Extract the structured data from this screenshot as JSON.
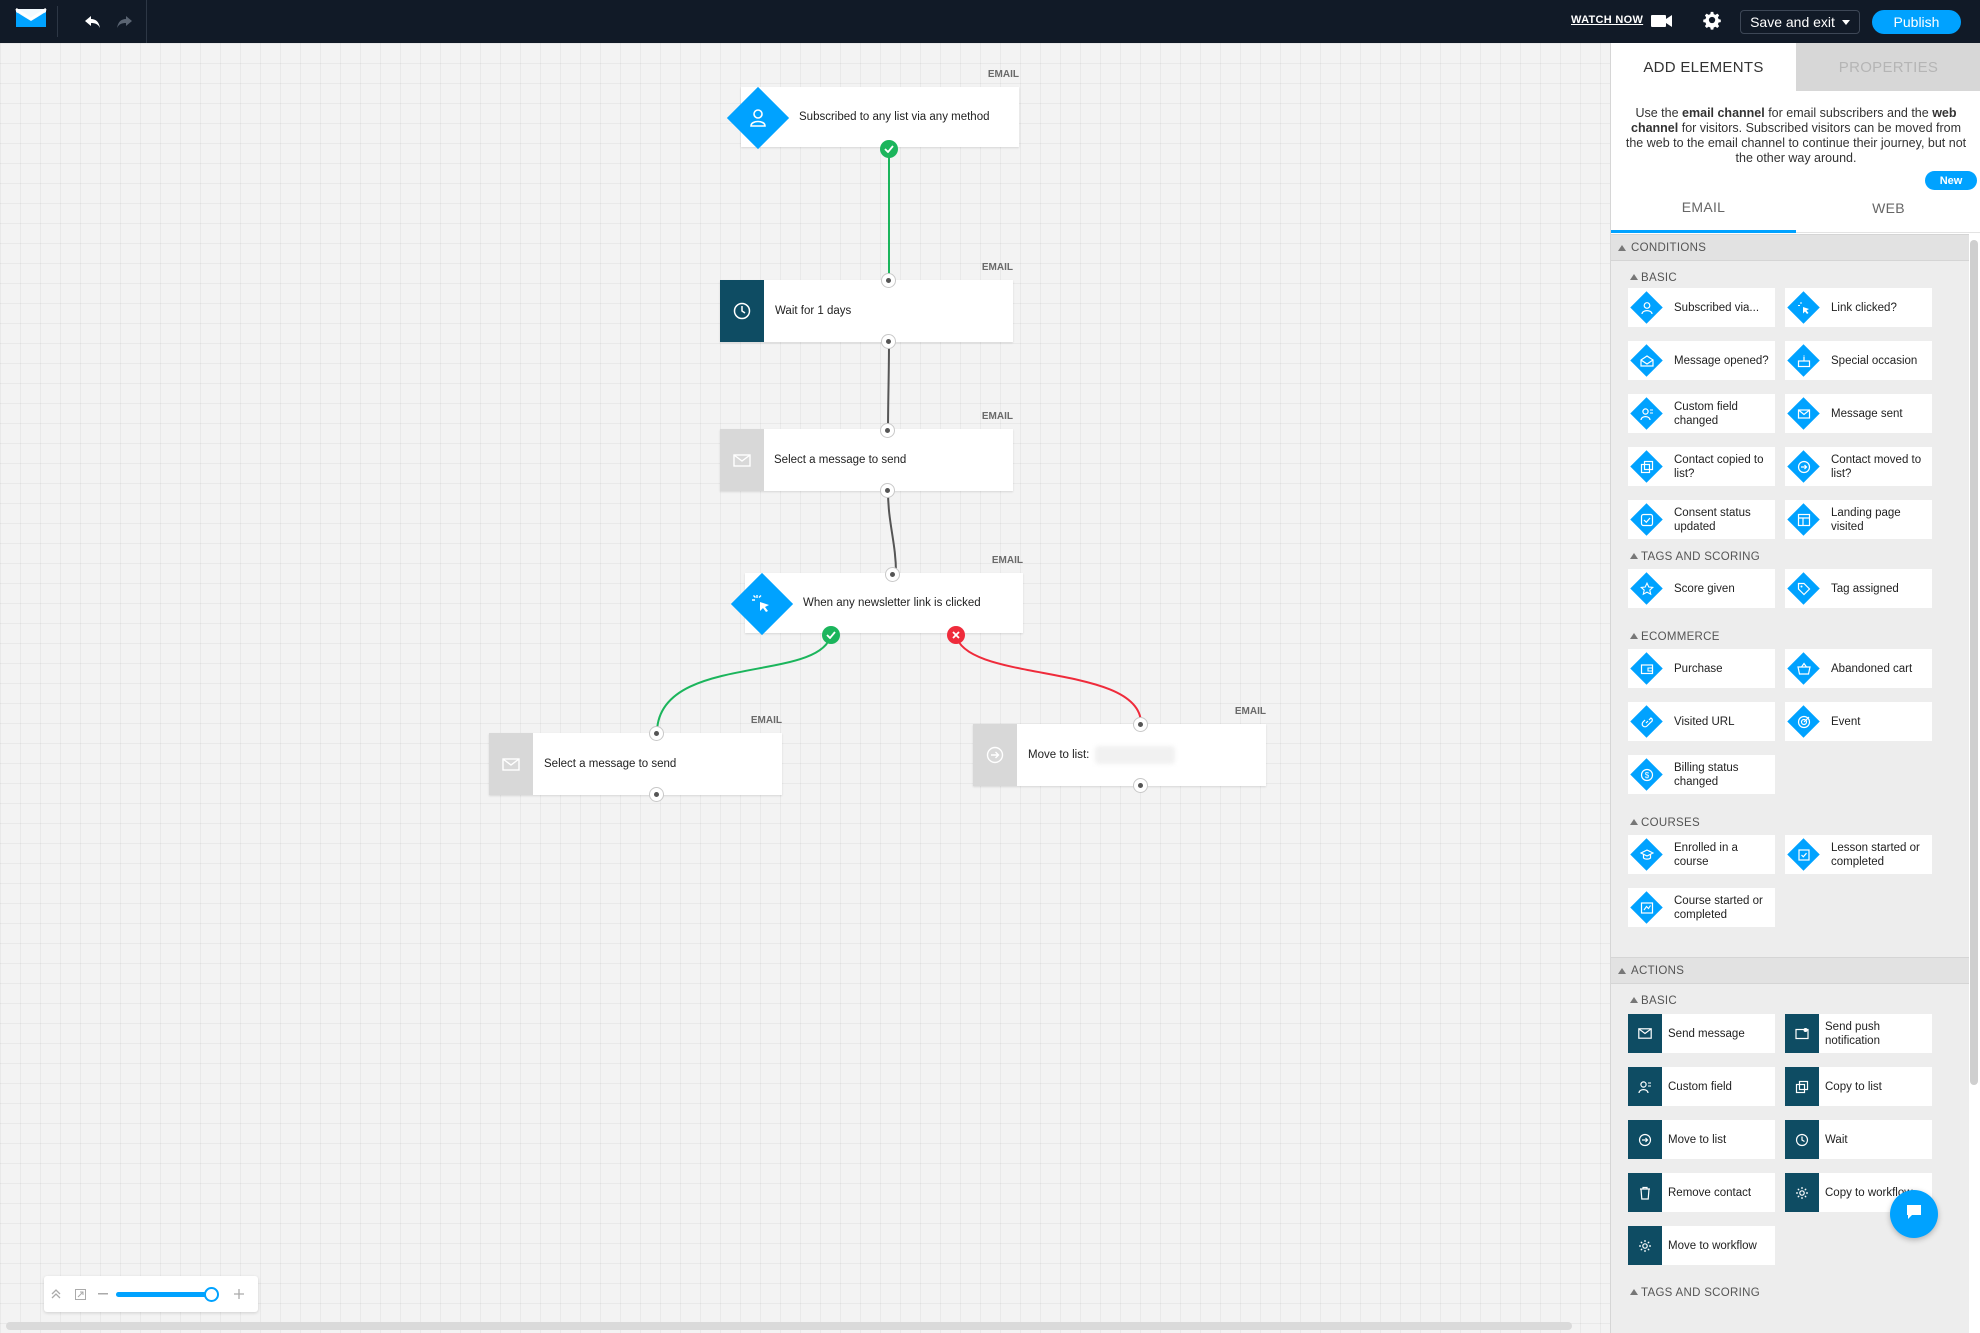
{
  "topbar": {
    "watch_now": "WATCH NOW",
    "save_exit": "Save and exit",
    "publish": "Publish"
  },
  "panel": {
    "tab_add": "ADD ELEMENTS",
    "tab_properties": "PROPERTIES",
    "desc_parts": [
      "Use the ",
      "email channel",
      " for email subscribers and the ",
      "web channel",
      " for visitors. Subscribed visitors can be moved from the web to the email channel to continue their journey, but not the other way around."
    ],
    "channel_email": "EMAIL",
    "channel_web": "WEB",
    "new_badge": "New",
    "conditions": "CONDITIONS",
    "cond_basic": "BASIC",
    "cond_basic_items": [
      "Subscribed via...",
      "Link clicked?",
      "Message opened?",
      "Special occasion",
      "Custom field changed",
      "Message sent",
      "Contact copied to list?",
      "Contact moved to list?",
      "Consent status updated",
      "Landing page visited"
    ],
    "tags_scoring": "TAGS AND SCORING",
    "tags_items": [
      "Score given",
      "Tag assigned"
    ],
    "ecommerce": "ECOMMERCE",
    "ecom_items": [
      "Purchase",
      "Abandoned cart",
      "Visited URL",
      "Event",
      "Billing status changed"
    ],
    "courses": "COURSES",
    "course_items": [
      "Enrolled in a course",
      "Lesson started or completed",
      "Course started or completed"
    ],
    "actions": "ACTIONS",
    "act_basic": "BASIC",
    "act_items": [
      "Send message",
      "Send push notification",
      "Custom field",
      "Copy to list",
      "Move to list",
      "Wait",
      "Remove contact",
      "Copy to workflow",
      "Move to workflow"
    ],
    "act_tags_scoring": "TAGS AND SCORING"
  },
  "workflow": {
    "channel_label": "EMAIL",
    "nodes": {
      "start": "Subscribed to any list via any method",
      "wait": "Wait for 1 days",
      "msg1": "Select a message to send",
      "link": "When any newsletter link is clicked",
      "msg2": "Select a message to send",
      "move": "Move to list:"
    }
  },
  "colors": {
    "accent": "#00a2ff",
    "dark_navy": "#111a27",
    "action_teal": "#0e4c63",
    "yes_green": "#1bb55c",
    "no_red": "#ef2b3b"
  },
  "zoom": {
    "level": 0.95
  }
}
